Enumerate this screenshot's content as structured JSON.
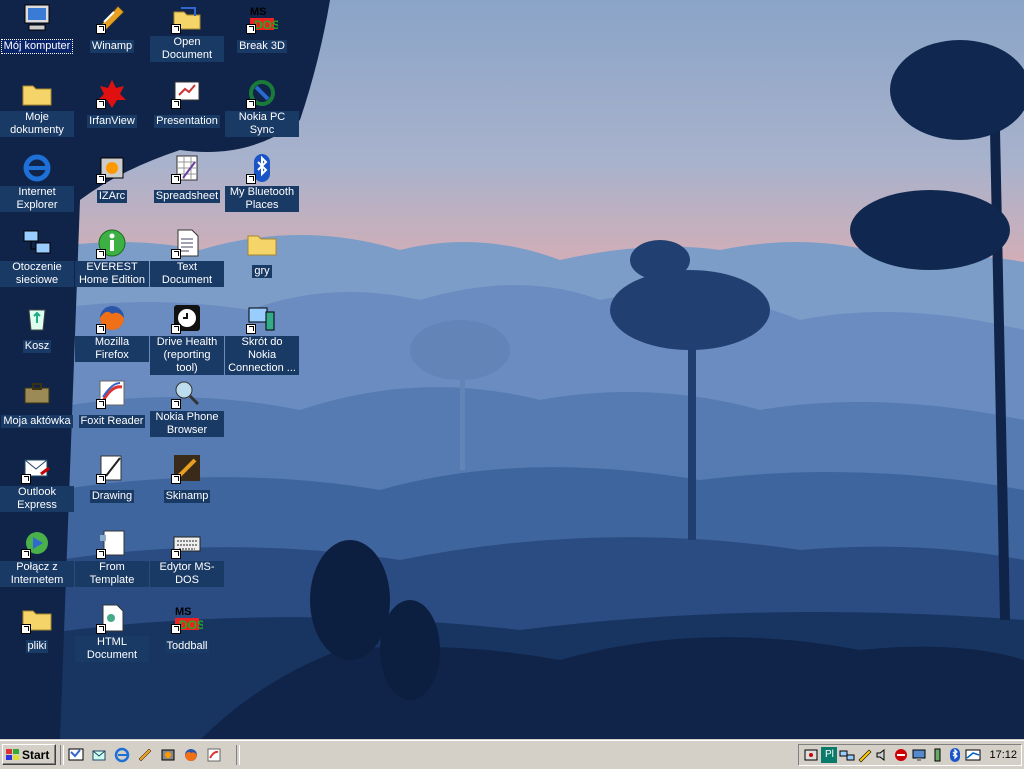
{
  "desktop": {
    "icons": [
      {
        "label": "Mój komputer",
        "icon": "computer-icon"
      },
      {
        "label": "Moje dokumenty",
        "icon": "folder-icon"
      },
      {
        "label": "Internet Explorer",
        "icon": "internet-explorer-icon"
      },
      {
        "label": "Otoczenie sieciowe",
        "icon": "network-icon"
      },
      {
        "label": "Kosz",
        "icon": "recycle-bin-icon"
      },
      {
        "label": "Moja aktówka",
        "icon": "briefcase-icon"
      },
      {
        "label": "Outlook Express",
        "icon": "outlook-icon"
      },
      {
        "label": "Połącz z Internetem",
        "icon": "connect-icon"
      },
      {
        "label": "pliki",
        "icon": "folder-icon"
      },
      {
        "label": "Winamp",
        "icon": "winamp-icon"
      },
      {
        "label": "IrfanView",
        "icon": "irfanview-icon"
      },
      {
        "label": "IZArc",
        "icon": "izarc-icon"
      },
      {
        "label": "EVEREST Home Edition",
        "icon": "everest-icon"
      },
      {
        "label": "Mozilla Firefox",
        "icon": "firefox-icon"
      },
      {
        "label": "Foxit Reader",
        "icon": "foxit-icon"
      },
      {
        "label": "Drawing",
        "icon": "drawing-icon"
      },
      {
        "label": "From Template",
        "icon": "template-icon"
      },
      {
        "label": "HTML Document",
        "icon": "html-document-icon"
      },
      {
        "label": "Open Document",
        "icon": "open-document-icon"
      },
      {
        "label": "Presentation",
        "icon": "presentation-icon"
      },
      {
        "label": "Spreadsheet",
        "icon": "spreadsheet-icon"
      },
      {
        "label": "Text Document",
        "icon": "text-document-icon"
      },
      {
        "label": "Drive Health (reporting tool)",
        "icon": "drive-health-icon"
      },
      {
        "label": "Nokia Phone Browser",
        "icon": "nokia-browser-icon"
      },
      {
        "label": "Skinamp",
        "icon": "skinamp-icon"
      },
      {
        "label": "Edytor MS-DOS",
        "icon": "keyboard-icon"
      },
      {
        "label": "Toddball",
        "icon": "msdos-icon"
      },
      {
        "label": "Break 3D",
        "icon": "msdos-icon"
      },
      {
        "label": "Nokia PC Sync",
        "icon": "nokia-sync-icon"
      },
      {
        "label": "My Bluetooth Places",
        "icon": "bluetooth-icon"
      },
      {
        "label": "gry",
        "icon": "folder-icon"
      },
      {
        "label": "Skrót do Nokia Connection ...",
        "icon": "nokia-connection-icon"
      }
    ]
  },
  "taskbar": {
    "start_label": "Start",
    "clock": "17:12",
    "tray_lang": "Pl"
  },
  "colors": {
    "label_bg": "#1a3a66",
    "taskbar": "#d4d0c8"
  }
}
